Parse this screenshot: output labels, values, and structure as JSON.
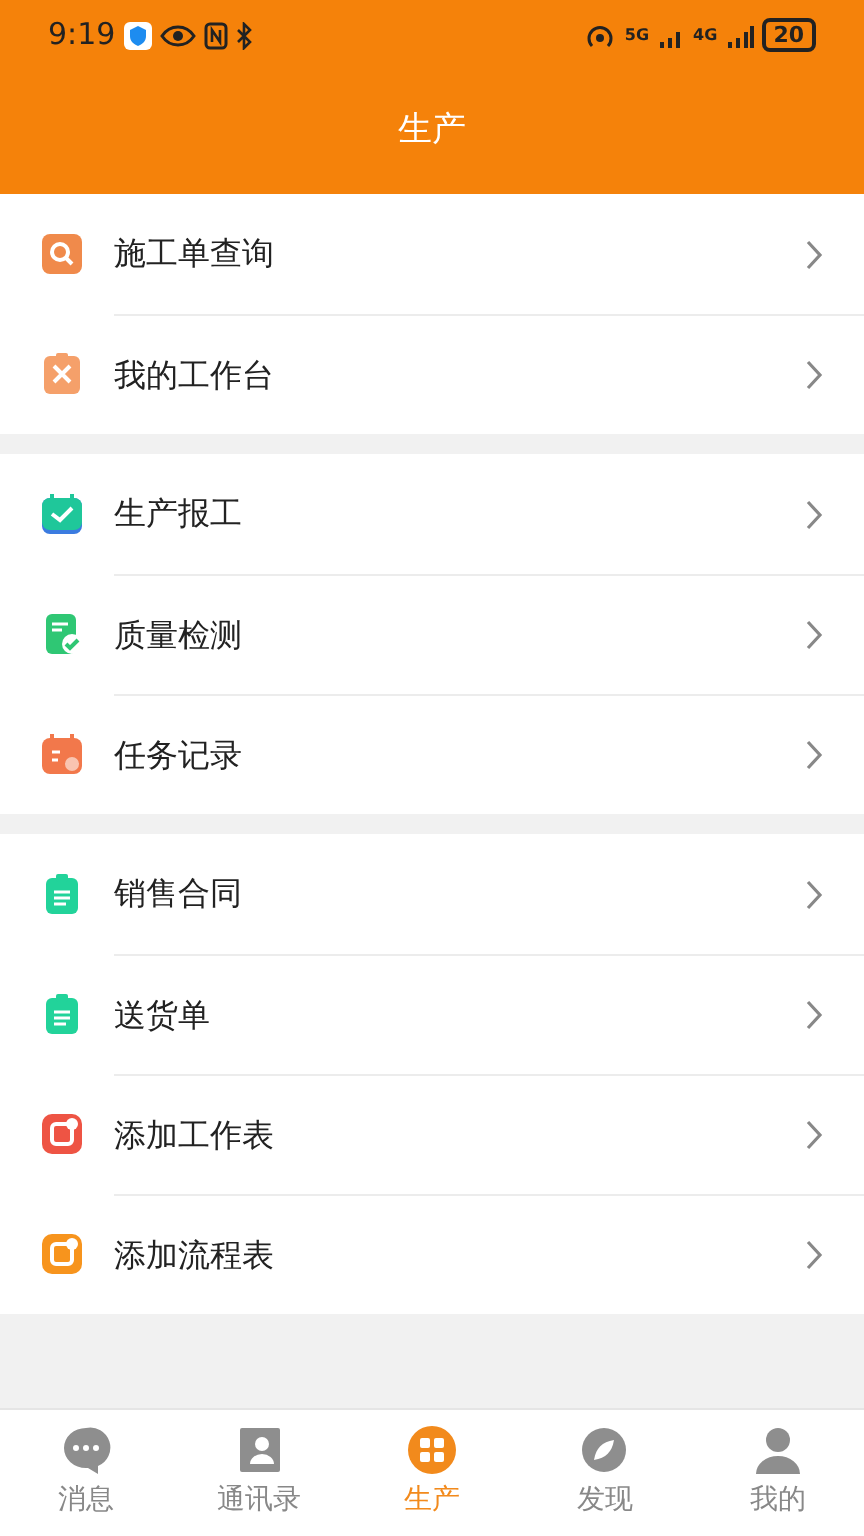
{
  "status_bar": {
    "time": "9:19",
    "net_1": "5G",
    "net_2": "4G",
    "battery": "20"
  },
  "header": {
    "title": "生产"
  },
  "groups": [
    {
      "items": [
        {
          "label": "施工单查询",
          "kind": "search",
          "color": "#f08a4b"
        },
        {
          "label": "我的工作台",
          "kind": "tools",
          "color": "#f5a06a"
        }
      ]
    },
    {
      "items": [
        {
          "label": "生产报工",
          "kind": "calendar-check",
          "color": "#1fc79a"
        },
        {
          "label": "质量检测",
          "kind": "doc-check",
          "color": "#2fc774"
        },
        {
          "label": "任务记录",
          "kind": "calendar-gear",
          "color": "#f2784b"
        }
      ]
    },
    {
      "items": [
        {
          "label": "销售合同",
          "kind": "clipboard",
          "color": "#22d39a"
        },
        {
          "label": "送货单",
          "kind": "clipboard",
          "color": "#22d39a"
        },
        {
          "label": "添加工作表",
          "kind": "note",
          "color": "#ee5444"
        },
        {
          "label": "添加流程表",
          "kind": "note",
          "color": "#f7941d"
        }
      ]
    }
  ],
  "tabs": [
    {
      "label": "消息",
      "kind": "chat",
      "selected": false
    },
    {
      "label": "通讯录",
      "kind": "contacts",
      "selected": false
    },
    {
      "label": "生产",
      "kind": "grid",
      "selected": true
    },
    {
      "label": "发现",
      "kind": "compass",
      "selected": false
    },
    {
      "label": "我的",
      "kind": "person",
      "selected": false
    }
  ]
}
